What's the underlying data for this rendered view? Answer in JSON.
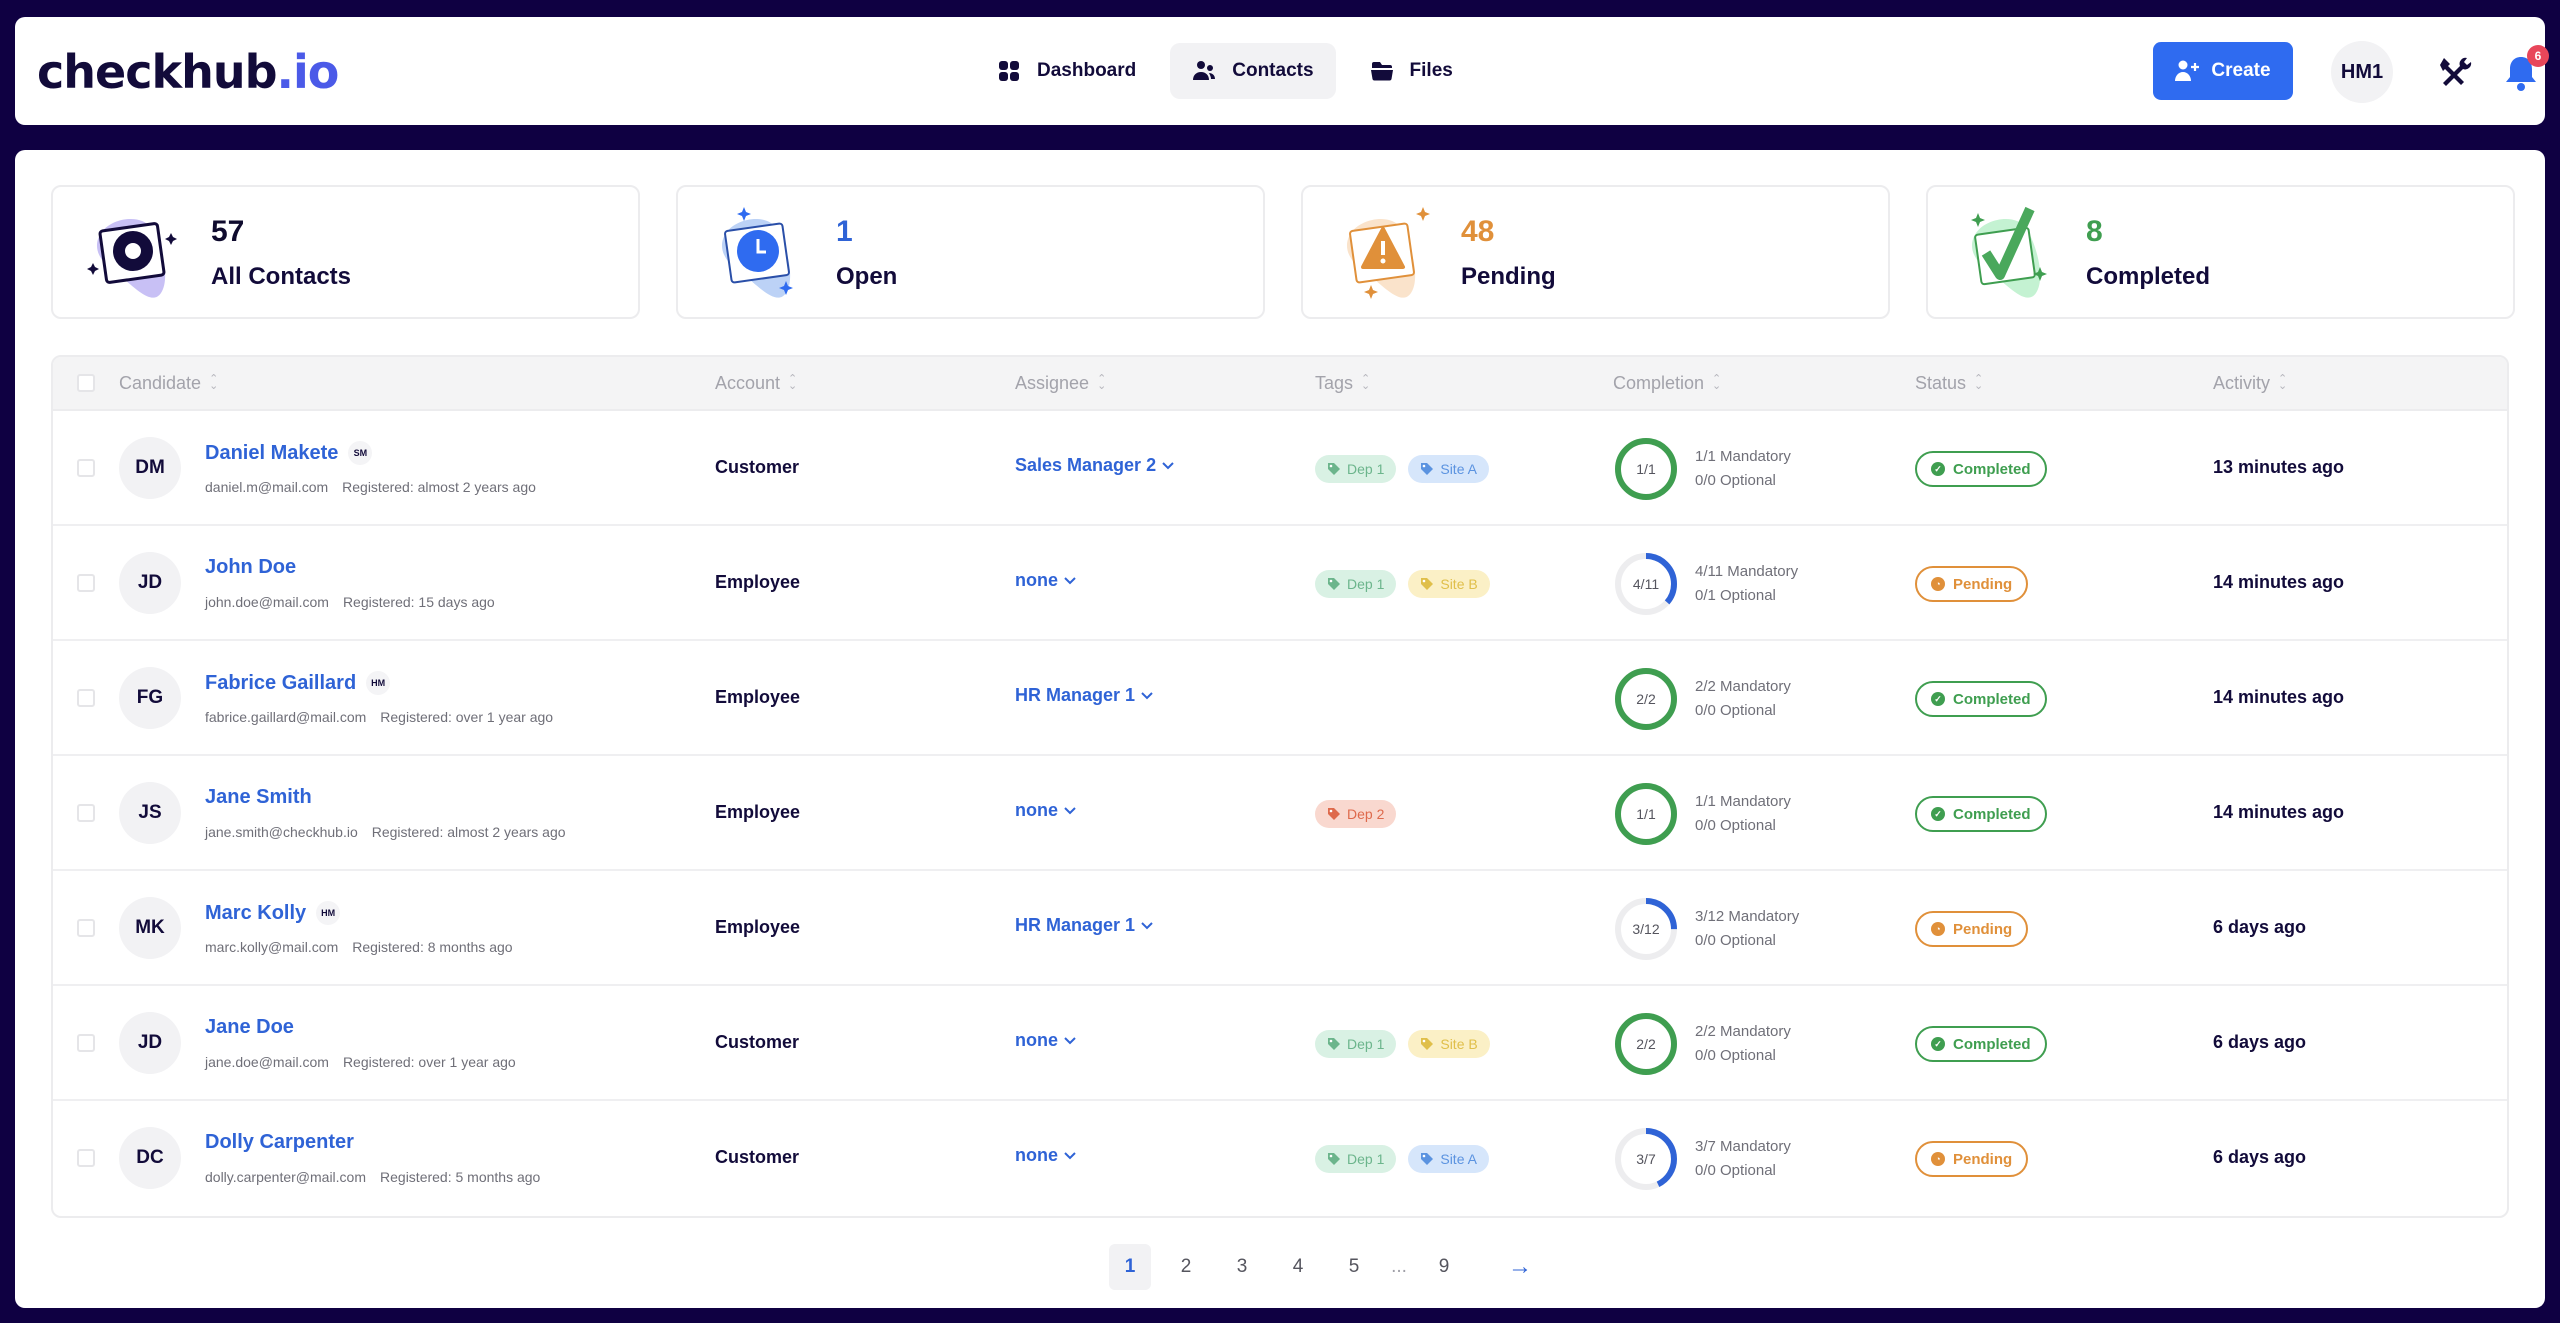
{
  "header": {
    "logo_main": "checkhub",
    "logo_accent": ".io",
    "nav": [
      {
        "label": "Dashboard",
        "icon": "dashboard-grid-icon",
        "active": false
      },
      {
        "label": "Contacts",
        "icon": "users-icon",
        "active": true
      },
      {
        "label": "Files",
        "icon": "folder-icon",
        "active": false
      }
    ],
    "create_label": "Create",
    "user_initials": "HM1",
    "notification_count": "6"
  },
  "stats": [
    {
      "count": "57",
      "label": "All Contacts",
      "color": "#0f0b2e",
      "icon": "gear-icon"
    },
    {
      "count": "1",
      "label": "Open",
      "color": "#2f63d6",
      "icon": "clock-icon"
    },
    {
      "count": "48",
      "label": "Pending",
      "color": "#e0903a",
      "icon": "warning-icon"
    },
    {
      "count": "8",
      "label": "Completed",
      "color": "#3f9e50",
      "icon": "check-icon"
    }
  ],
  "table": {
    "columns": [
      "Candidate",
      "Account",
      "Assignee",
      "Tags",
      "Completion",
      "Status",
      "Activity"
    ],
    "rows": [
      {
        "initials": "DM",
        "name": "Daniel Makete",
        "role": "SM",
        "email": "daniel.m@mail.com",
        "registered": "Registered: almost 2 years ago",
        "account": "Customer",
        "assignee": "Sales Manager 2",
        "tags": [
          {
            "label": "Dep 1",
            "color": "green"
          },
          {
            "label": "Site A",
            "color": "blue"
          }
        ],
        "done": 1,
        "total": 1,
        "ring": "1/1",
        "mandatory": "1/1 Mandatory",
        "optional": "0/0 Optional",
        "status": "Completed",
        "activity": "13 minutes ago"
      },
      {
        "initials": "JD",
        "name": "John Doe",
        "role": "",
        "email": "john.doe@mail.com",
        "registered": "Registered: 15 days ago",
        "account": "Employee",
        "assignee": "none",
        "tags": [
          {
            "label": "Dep 1",
            "color": "green"
          },
          {
            "label": "Site B",
            "color": "yellow"
          }
        ],
        "done": 4,
        "total": 11,
        "ring": "4/11",
        "mandatory": "4/11 Mandatory",
        "optional": "0/1 Optional",
        "status": "Pending",
        "activity": "14 minutes ago"
      },
      {
        "initials": "FG",
        "name": "Fabrice Gaillard",
        "role": "HM",
        "email": "fabrice.gaillard@mail.com",
        "registered": "Registered: over 1 year ago",
        "account": "Employee",
        "assignee": "HR Manager 1",
        "tags": [],
        "done": 2,
        "total": 2,
        "ring": "2/2",
        "mandatory": "2/2 Mandatory",
        "optional": "0/0 Optional",
        "status": "Completed",
        "activity": "14 minutes ago"
      },
      {
        "initials": "JS",
        "name": "Jane Smith",
        "role": "",
        "email": "jane.smith@checkhub.io",
        "registered": "Registered: almost 2 years ago",
        "account": "Employee",
        "assignee": "none",
        "tags": [
          {
            "label": "Dep 2",
            "color": "red"
          }
        ],
        "done": 1,
        "total": 1,
        "ring": "1/1",
        "mandatory": "1/1 Mandatory",
        "optional": "0/0 Optional",
        "status": "Completed",
        "activity": "14 minutes ago"
      },
      {
        "initials": "MK",
        "name": "Marc Kolly",
        "role": "HM",
        "email": "marc.kolly@mail.com",
        "registered": "Registered: 8 months ago",
        "account": "Employee",
        "assignee": "HR Manager 1",
        "tags": [],
        "done": 3,
        "total": 12,
        "ring": "3/12",
        "mandatory": "3/12 Mandatory",
        "optional": "0/0 Optional",
        "status": "Pending",
        "activity": "6 days ago"
      },
      {
        "initials": "JD",
        "name": "Jane Doe",
        "role": "",
        "email": "jane.doe@mail.com",
        "registered": "Registered: over 1 year ago",
        "account": "Customer",
        "assignee": "none",
        "tags": [
          {
            "label": "Dep 1",
            "color": "green"
          },
          {
            "label": "Site B",
            "color": "yellow"
          }
        ],
        "done": 2,
        "total": 2,
        "ring": "2/2",
        "mandatory": "2/2 Mandatory",
        "optional": "0/0 Optional",
        "status": "Completed",
        "activity": "6 days ago"
      },
      {
        "initials": "DC",
        "name": "Dolly Carpenter",
        "role": "",
        "email": "dolly.carpenter@mail.com",
        "registered": "Registered: 5 months ago",
        "account": "Customer",
        "assignee": "none",
        "tags": [
          {
            "label": "Dep 1",
            "color": "green"
          },
          {
            "label": "Site A",
            "color": "blue"
          }
        ],
        "done": 3,
        "total": 7,
        "ring": "3/7",
        "mandatory": "3/7 Mandatory",
        "optional": "0/0 Optional",
        "status": "Pending",
        "activity": "6 days ago"
      }
    ]
  },
  "pagination": {
    "pages": [
      "1",
      "2",
      "3",
      "4",
      "5"
    ],
    "ellipsis": "...",
    "last": "9",
    "current": "1",
    "next_icon": "arrow-right-icon"
  },
  "colors": {
    "brand_dark": "#0f0042",
    "accent_blue": "#2f6bf0",
    "completed_green": "#3f9e50",
    "pending_orange": "#e0903a",
    "progress_blue": "#2f63d6"
  }
}
